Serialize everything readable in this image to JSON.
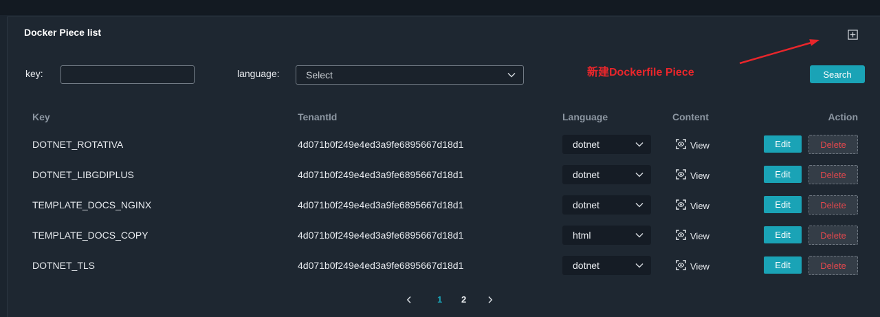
{
  "panel": {
    "title": "Docker Piece list"
  },
  "annotation": {
    "text": "新建Dockerfile Piece"
  },
  "filters": {
    "key_label": "key:",
    "key_value": "",
    "language_label": "language:",
    "language_placeholder": "Select",
    "search_label": "Search"
  },
  "table": {
    "headers": {
      "key": "Key",
      "tenant_id": "TenantId",
      "language": "Language",
      "content": "Content",
      "action": "Action"
    },
    "rows": [
      {
        "key": "DOTNET_ROTATIVA",
        "tenant_id": "4d071b0f249e4ed3a9fe6895667d18d1",
        "language": "dotnet"
      },
      {
        "key": "DOTNET_LIBGDIPLUS",
        "tenant_id": "4d071b0f249e4ed3a9fe6895667d18d1",
        "language": "dotnet"
      },
      {
        "key": "TEMPLATE_DOCS_NGINX",
        "tenant_id": "4d071b0f249e4ed3a9fe6895667d18d1",
        "language": "dotnet"
      },
      {
        "key": "TEMPLATE_DOCS_COPY",
        "tenant_id": "4d071b0f249e4ed3a9fe6895667d18d1",
        "language": "html"
      },
      {
        "key": "DOTNET_TLS",
        "tenant_id": "4d071b0f249e4ed3a9fe6895667d18d1",
        "language": "dotnet"
      }
    ],
    "view_label": "View",
    "edit_label": "Edit",
    "delete_label": "Delete"
  },
  "pagination": {
    "pages": [
      {
        "label": "1",
        "active": true
      },
      {
        "label": "2",
        "active": false
      }
    ]
  },
  "icons": {
    "add": "plus-square-icon",
    "dropdown": "chevron-down-icon",
    "view": "view-icon",
    "prev_page": "chevron-left-icon",
    "next_page": "chevron-right-icon"
  },
  "colors": {
    "bg": "#1b242e",
    "panel": "#1e2731",
    "accent": "#1aa3b6",
    "danger": "#e5484d",
    "annotation": "#e8262b",
    "text": "#e8ebef",
    "muted": "#8d97a2"
  }
}
